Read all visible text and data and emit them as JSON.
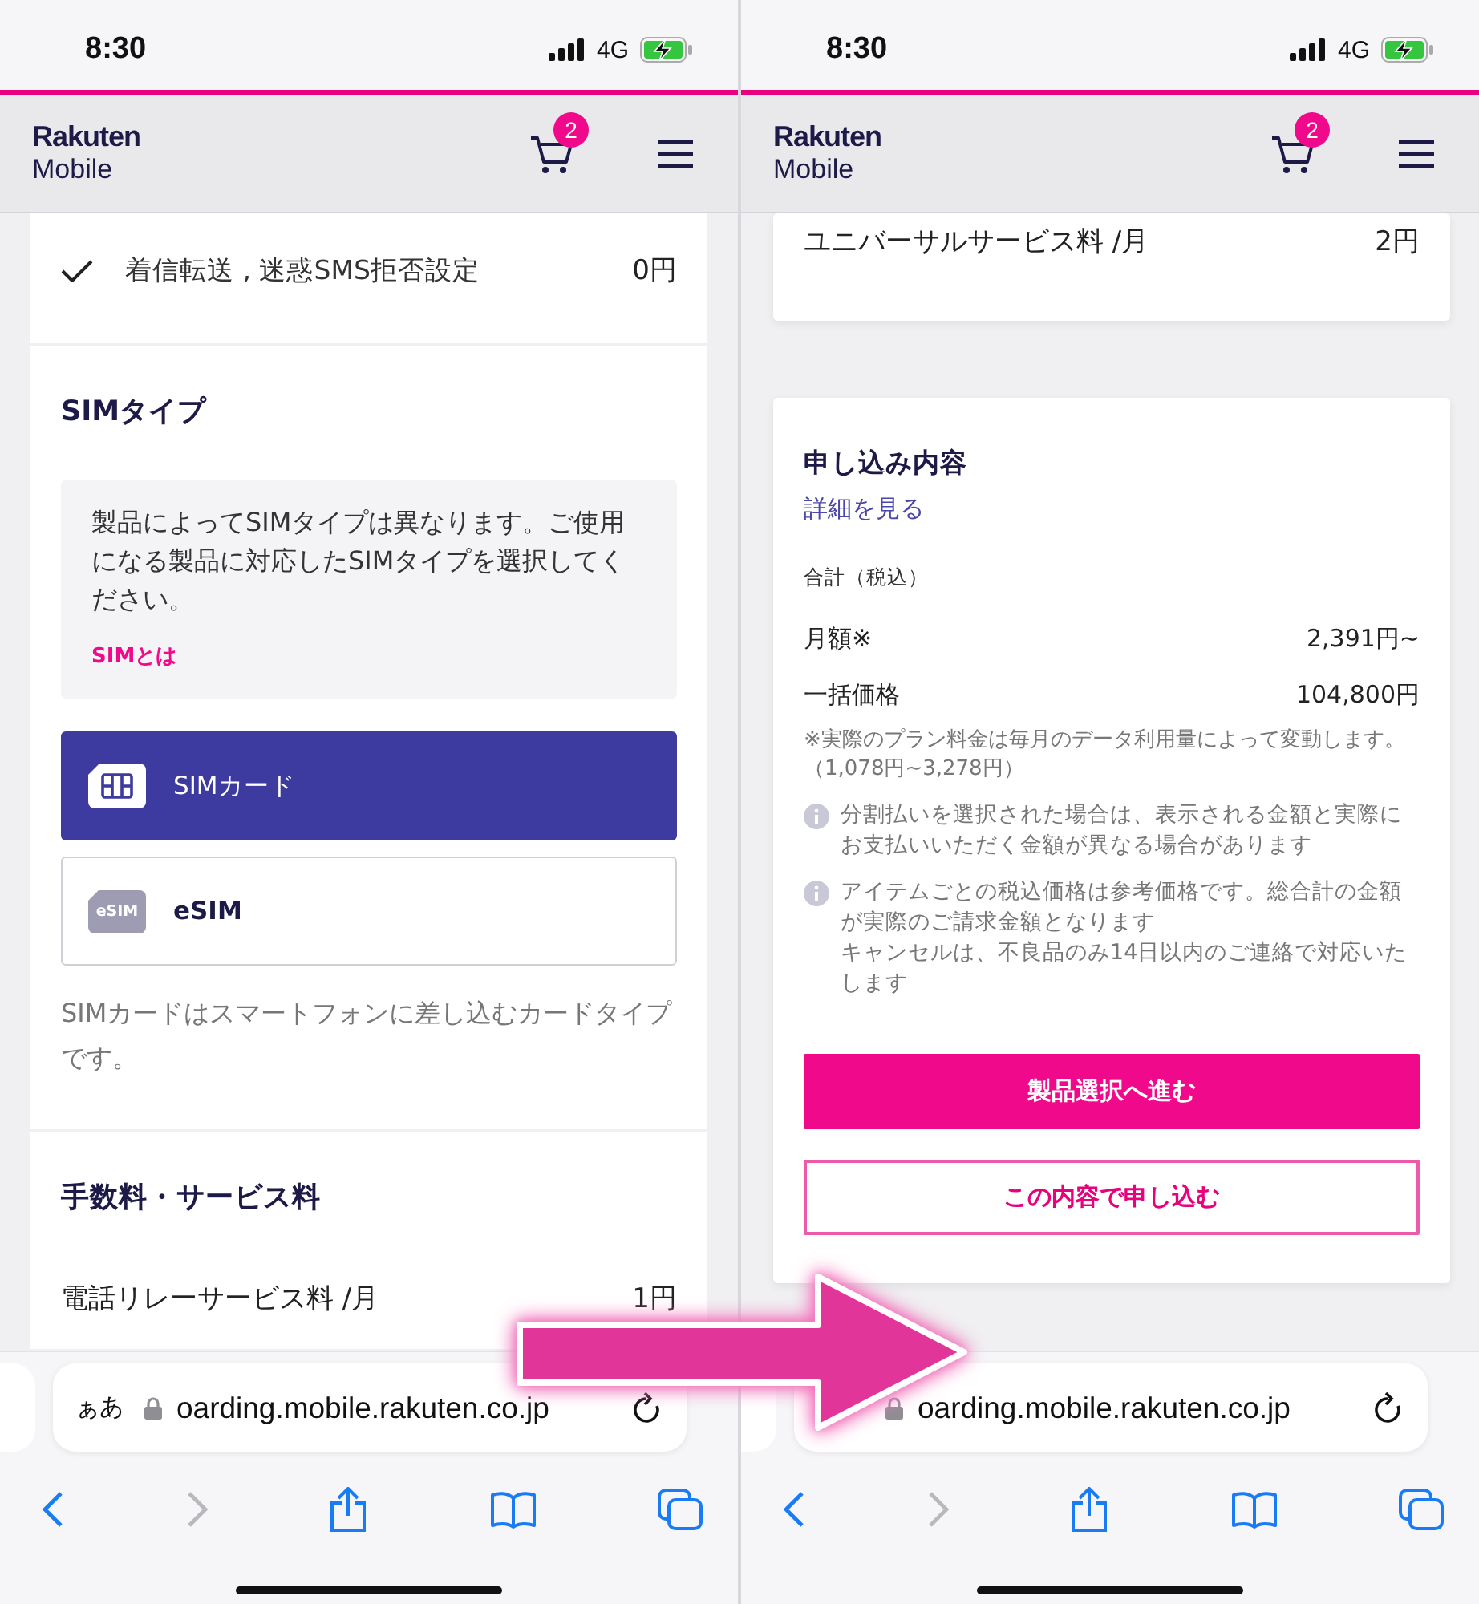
{
  "screens": [
    {
      "status_bar": {
        "time": "8:30",
        "network": "4G"
      },
      "header": {
        "logo_line1": "Rakuten",
        "logo_line2": "Mobile",
        "cart_count": "2"
      },
      "cards": [
        {
          "kind": "plain",
          "items": [
            {
              "kind": "check_row",
              "label": "着信転送 , 迷惑SMS拒否設定",
              "price": "0円",
              "checked": true
            }
          ]
        },
        {
          "kind": "plain",
          "items": [
            {
              "kind": "heading",
              "text": "SIMタイプ"
            },
            {
              "kind": "info_box",
              "text": "製品によってSIMタイプは異なります。ご使用になる製品に対応したSIMタイプを選択してください。",
              "link": "SIMとは"
            },
            {
              "kind": "sim_card_option",
              "label": "SIMカード",
              "selected": true
            },
            {
              "kind": "esim_option",
              "badge": "eSIM",
              "label": "eSIM",
              "selected": false
            },
            {
              "kind": "description",
              "text": "SIMカードはスマートフォンに差し込むカードタイプです。"
            }
          ]
        },
        {
          "kind": "plain",
          "items": [
            {
              "kind": "heading",
              "text": "手数料・サービス料"
            },
            {
              "kind": "price_row",
              "label": "電話リレーサービス料 /月",
              "price": "1円"
            }
          ]
        }
      ],
      "url_bar": {
        "text_size_label": "ぁあ",
        "url": "oarding.mobile.rakuten.co.jp"
      },
      "toolbar": [
        {
          "kind": "back",
          "disabled": false
        },
        {
          "kind": "forward",
          "disabled": true
        },
        {
          "kind": "share",
          "disabled": false
        },
        {
          "kind": "bookmarks",
          "disabled": false
        },
        {
          "kind": "tabs",
          "disabled": false
        }
      ]
    },
    {
      "status_bar": {
        "time": "8:30",
        "network": "4G"
      },
      "header": {
        "logo_line1": "Rakuten",
        "logo_line2": "Mobile",
        "cart_count": "2"
      },
      "cards": [
        {
          "kind": "floating",
          "items": [
            {
              "kind": "price_row_top",
              "label": "ユニバーサルサービス料 /月",
              "price": "2円"
            }
          ]
        },
        {
          "kind": "floating",
          "items": [
            {
              "kind": "summary_heading",
              "text": "申し込み内容"
            },
            {
              "kind": "link",
              "text": "詳細を見る"
            },
            {
              "kind": "caption",
              "text": "合計（税込）"
            },
            {
              "kind": "total_row",
              "label": "月額※",
              "price": "2,391円~"
            },
            {
              "kind": "total_row",
              "label": "一括価格",
              "price": "104,800円"
            },
            {
              "kind": "note",
              "text": "※実際のプラン料金は毎月のデータ利用量によって変動します。（1,078円~3,278円）"
            },
            {
              "kind": "info_note",
              "lines": [
                "分割払いを選択された場合は、表示される金額と実際にお支払いいただく金額が異なる場合があります"
              ]
            },
            {
              "kind": "info_note",
              "lines": [
                "アイテムごとの税込価格は参考価格です。総合計の金額が実際のご請求金額となります",
                "キャンセルは、不良品のみ14日以内のご連絡で対応いたします"
              ]
            },
            {
              "kind": "primary_button",
              "label": "製品選択へ進む"
            },
            {
              "kind": "secondary_button",
              "label": "この内容で申し込む"
            }
          ]
        }
      ],
      "url_bar": {
        "url": "oarding.mobile.rakuten.co.jp"
      },
      "toolbar": [
        {
          "kind": "back",
          "disabled": false
        },
        {
          "kind": "forward",
          "disabled": true
        },
        {
          "kind": "share",
          "disabled": false
        },
        {
          "kind": "bookmarks",
          "disabled": false
        },
        {
          "kind": "tabs",
          "disabled": false
        }
      ]
    }
  ]
}
